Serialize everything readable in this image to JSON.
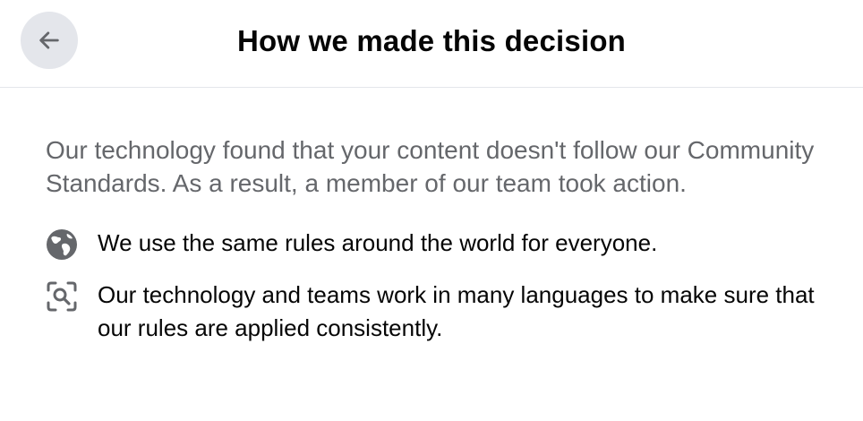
{
  "header": {
    "title": "How we made this decision",
    "back_icon": "arrow-left-icon"
  },
  "main": {
    "summary": "Our technology found that your content doesn't follow our Community Standards. As a result, a member of our team took action.",
    "bullets": [
      {
        "icon": "globe-icon",
        "text": "We use the same rules around the world for everyone."
      },
      {
        "icon": "scan-search-icon",
        "text": "Our technology and teams work in many languages to make sure that our rules are applied consistently."
      }
    ]
  },
  "colors": {
    "title": "#050505",
    "secondary_text": "#65676b",
    "icon": "#65676b",
    "back_button_bg": "#e4e6eb",
    "divider": "#e4e6eb"
  }
}
